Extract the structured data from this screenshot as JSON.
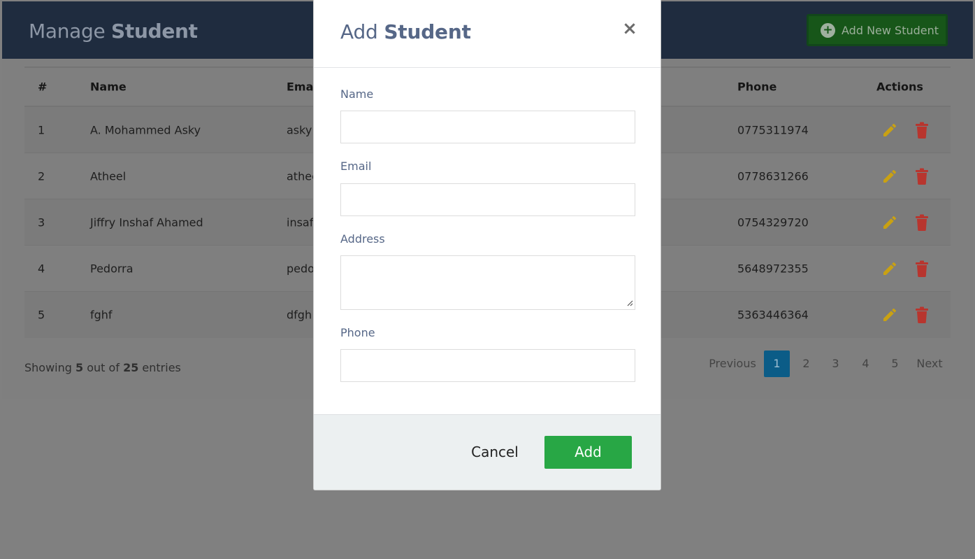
{
  "page": {
    "title_prefix": "Manage",
    "title_bold": "Student",
    "add_new_label": "Add New Student"
  },
  "table": {
    "headers": [
      "#",
      "Name",
      "Email",
      "Phone",
      "Actions"
    ],
    "rows": [
      {
        "num": "1",
        "name": "A. Mohammed Asky",
        "email": "asky",
        "phone": "0775311974"
      },
      {
        "num": "2",
        "name": "Atheel",
        "email": "athee",
        "phone": "0778631266"
      },
      {
        "num": "3",
        "name": "Jiffry Inshaf Ahamed",
        "email": "insaf",
        "phone": "0754329720"
      },
      {
        "num": "4",
        "name": "Pedorra",
        "email": "pedo",
        "phone": "5648972355"
      },
      {
        "num": "5",
        "name": "fghf",
        "email": "dfgh",
        "phone": "5363446364"
      }
    ]
  },
  "footer": {
    "showing_prefix": "Showing",
    "shown": "5",
    "out_of": "out of",
    "total": "25",
    "entries": "entries"
  },
  "pagination": {
    "previous": "Previous",
    "pages": [
      "1",
      "2",
      "3",
      "4",
      "5"
    ],
    "active": "1",
    "next": "Next"
  },
  "modal": {
    "title_prefix": "Add",
    "title_bold": "Student",
    "close_glyph": "×",
    "fields": {
      "name_label": "Name",
      "name_value": "",
      "email_label": "Email",
      "email_value": "",
      "address_label": "Address",
      "address_value": "",
      "phone_label": "Phone",
      "phone_value": ""
    },
    "cancel_label": "Cancel",
    "add_label": "Add"
  },
  "icons": {
    "edit": "pencil-icon",
    "delete": "trash-icon",
    "add": "plus-circle-icon",
    "close": "close-icon"
  },
  "colors": {
    "header_bg": "#1f2c3f",
    "add_new_btn": "#175619",
    "edit_icon": "#c9a113",
    "delete_icon": "#b8352e",
    "pager_active": "#0b5c87",
    "add_btn": "#28a745",
    "modal_title": "#566787"
  }
}
